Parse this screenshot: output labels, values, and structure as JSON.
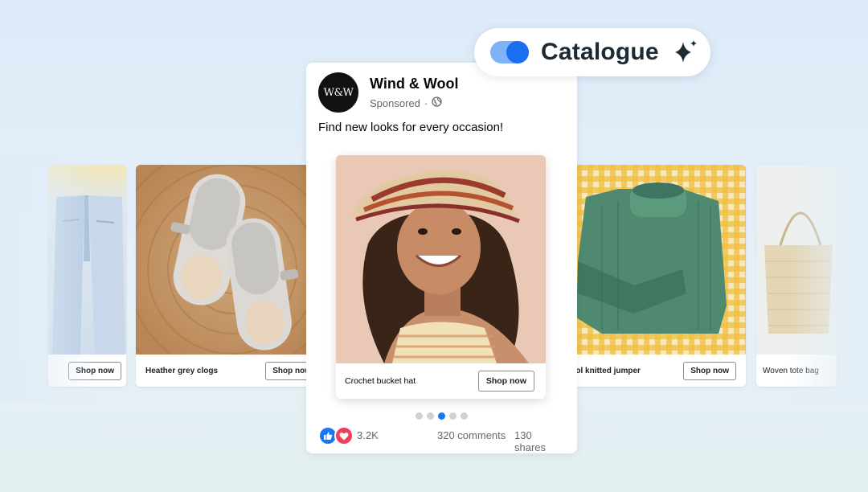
{
  "toggle": {
    "label": "Catalogue",
    "enabled": true
  },
  "post": {
    "avatar_text": "W&W",
    "page_name": "Wind & Wool",
    "sponsored_label": "Sponsored",
    "separator": "·",
    "caption": "Find new looks for every occasion!"
  },
  "carousel": {
    "items": [
      {
        "name": "",
        "cta": "Shop now"
      },
      {
        "name": "Heather grey clogs",
        "cta": "Shop now"
      },
      {
        "name": "Crochet bucket hat",
        "cta": "Shop now"
      },
      {
        "name": "Wool knitted jumper",
        "cta": "Shop now"
      },
      {
        "name": "Woven tote bag",
        "cta": ""
      }
    ],
    "active_index": 2,
    "dot_count": 5
  },
  "engagement": {
    "reactions": "3.2K",
    "comments": "320 comments",
    "shares": "130 shares"
  },
  "colors": {
    "accent": "#1877f2",
    "toggle_track": "#7fb2f6",
    "toggle_knob": "#1a6ff1",
    "heart": "#f33e58"
  }
}
